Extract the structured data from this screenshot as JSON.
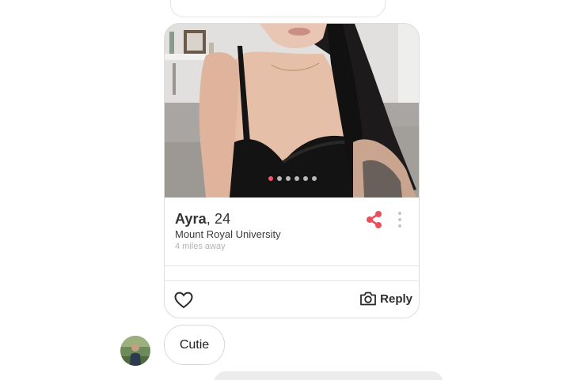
{
  "profile_card": {
    "photo": {
      "indicator": {
        "total": 6,
        "active_index": 0
      },
      "colors": {
        "active_dot": "#fd5068",
        "inactive_dot": "#ffffff"
      }
    },
    "name": "Ayra",
    "age_text": ", 24",
    "school": "Mount Royal University",
    "distance": "4 miles away",
    "share_icon": "share-icon",
    "more_icon": "more-vertical-icon",
    "like_icon": "heart-icon",
    "reply": {
      "icon": "camera-icon",
      "label": "Reply"
    },
    "colors": {
      "share": "#e8505b",
      "text": "#333333",
      "muted": "#b3b3b3"
    }
  },
  "chat": {
    "message": {
      "text": "Cutie"
    },
    "avatar_icon": "user-avatar"
  }
}
